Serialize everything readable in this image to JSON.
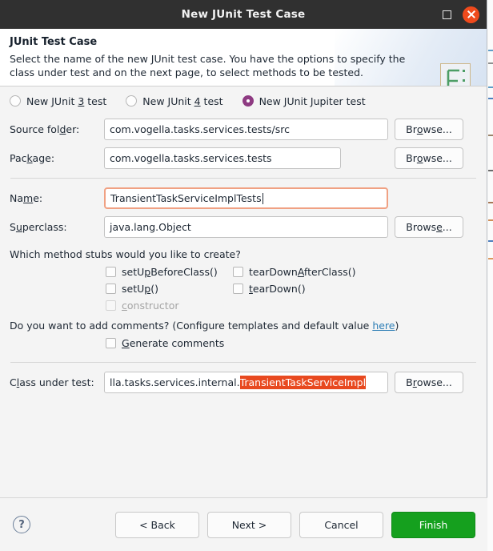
{
  "window": {
    "title": "New JUnit Test Case",
    "maximize_icon": "maximize-icon",
    "close_icon": "close-icon"
  },
  "header": {
    "title": "JUnit Test Case",
    "description": "Select the name of the new JUnit test case. You have the options to specify the class under test and on the next page, to select methods to be tested.",
    "icon": "junit-wizard-icon"
  },
  "test_kind": {
    "options": [
      {
        "label_pre": "New JUnit ",
        "mnemonic": "3",
        "label_post": " test",
        "selected": false
      },
      {
        "label_pre": "New JUnit ",
        "mnemonic": "4",
        "label_post": " test",
        "selected": false
      },
      {
        "label_pre": "New JUnit ",
        "mnemonic": "J",
        "label_post": "upiter test",
        "selected": true
      }
    ]
  },
  "fields": {
    "source_folder": {
      "label_pre": "Source fol",
      "label_mn": "d",
      "label_post": "er:",
      "value": "com.vogella.tasks.services.tests/src",
      "browse_pre": "Br",
      "browse_mn": "o",
      "browse_post": "wse..."
    },
    "package": {
      "label_pre": "Pac",
      "label_mn": "k",
      "label_post": "age:",
      "value": "com.vogella.tasks.services.tests",
      "browse_pre": "Br",
      "browse_mn": "o",
      "browse_post": "wse..."
    },
    "name": {
      "label_pre": "Na",
      "label_mn": "m",
      "label_post": "e:",
      "value": "TransientTaskServiceImplTests",
      "focused": true
    },
    "superclass": {
      "label_pre": "S",
      "label_mn": "u",
      "label_post": "perclass:",
      "value": "java.lang.Object",
      "browse_pre": "Brows",
      "browse_mn": "e",
      "browse_post": "..."
    },
    "class_under_test": {
      "label_pre": "C",
      "label_mn": "l",
      "label_post": "ass under test:",
      "value_plain": "lla.tasks.services.internal.",
      "value_selected": "TransientTaskServiceImpl",
      "browse_pre": "B",
      "browse_mn": "r",
      "browse_post": "owse..."
    }
  },
  "stubs": {
    "question": "Which method stubs would you like to create?",
    "items": [
      {
        "pre": "setU",
        "mn": "p",
        "post": "BeforeClass()",
        "checked": false,
        "enabled": true
      },
      {
        "pre": "tearDown",
        "mn": "A",
        "post": "fterClass()",
        "checked": false,
        "enabled": true
      },
      {
        "pre": "setU",
        "mn": "p",
        "post": "()",
        "checked": false,
        "enabled": true
      },
      {
        "pre": "",
        "mn": "t",
        "post": "earDown()",
        "checked": false,
        "enabled": true
      },
      {
        "pre": "",
        "mn": "c",
        "post": "onstructor",
        "checked": false,
        "enabled": false
      }
    ]
  },
  "comments": {
    "question_pre": "Do you want to add comments? (Configure templates and default value ",
    "link": "here",
    "question_post": ")",
    "generate_pre": "",
    "generate_mn": "G",
    "generate_post": "enerate comments",
    "generate_checked": false
  },
  "footer": {
    "help_icon": "help-icon",
    "buttons": [
      {
        "label": "< Back",
        "primary": false
      },
      {
        "label": "Next >",
        "primary": false
      },
      {
        "label": "Cancel",
        "primary": false
      },
      {
        "label": "Finish",
        "primary": true
      }
    ]
  },
  "colors": {
    "titlebar": "#303030",
    "close_button": "#ef4a1c",
    "radio_selected": "#8e3b82",
    "focus_border": "#f0a183",
    "text_selection": "#e8491f",
    "link": "#2c7db5",
    "finish_button": "#15a01e"
  }
}
